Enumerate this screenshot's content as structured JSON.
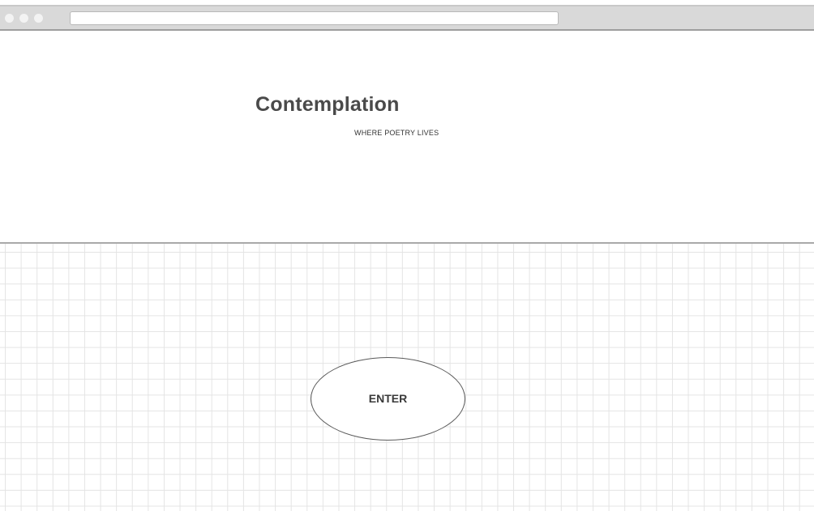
{
  "header": {
    "title": "Contemplation",
    "tagline": "WHERE POETRY LIVES"
  },
  "main": {
    "enter_label": "ENTER"
  },
  "colors": {
    "title": "#4a4a4a",
    "grid_line": "#e4e4e4",
    "chrome": "#d9d9d9",
    "divider": "#a9a9a9"
  },
  "icons": {
    "window_controls": [
      "window-dot-icon",
      "window-dot-icon",
      "window-dot-icon"
    ]
  }
}
